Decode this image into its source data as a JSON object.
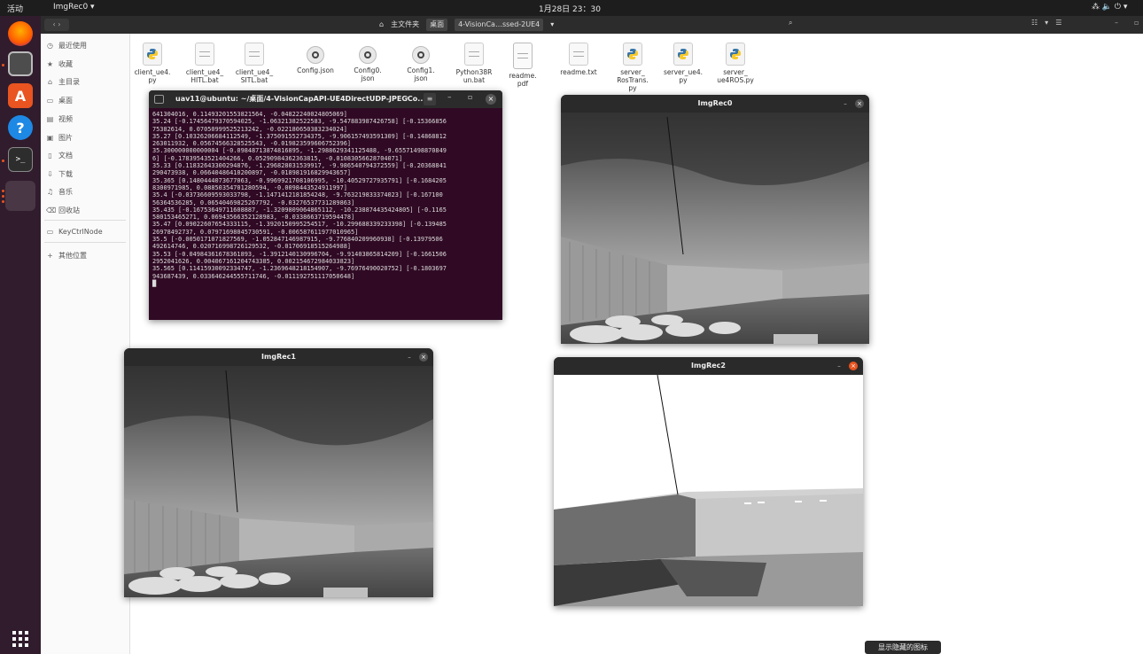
{
  "topbar": {
    "activities": "活动",
    "app_menu": "ImgRec0 ▾",
    "clock": "1月28日 23：30",
    "status_icons": "⁂ 🔈 ⏻ ▾"
  },
  "toolbar": {
    "path": [
      "主文件夹",
      "桌面",
      "4-VisionCa…ssed-2UE4"
    ],
    "path_dropdown": "▾"
  },
  "sidebar": {
    "items": [
      {
        "label": "最近使用",
        "icon": "clock-icon"
      },
      {
        "label": "收藏",
        "icon": "star-icon"
      },
      {
        "label": "主目录",
        "icon": "home-icon"
      },
      {
        "label": "桌面",
        "icon": "desktop-icon"
      },
      {
        "label": "视频",
        "icon": "video-icon"
      },
      {
        "label": "图片",
        "icon": "picture-icon"
      },
      {
        "label": "文档",
        "icon": "document-icon"
      },
      {
        "label": "下载",
        "icon": "download-icon"
      },
      {
        "label": "音乐",
        "icon": "music-icon"
      },
      {
        "label": "回收站",
        "icon": "trash-icon"
      },
      {
        "label": "KeyCtrlNode",
        "icon": "drive-icon"
      },
      {
        "label": "其他位置",
        "icon": "plus-icon"
      }
    ]
  },
  "files": [
    {
      "name": "client_ue4.\npy",
      "type": "python"
    },
    {
      "name": "client_ue4_\nHITL.bat",
      "type": "text"
    },
    {
      "name": "client_ue4_\nSITL.bat",
      "type": "text"
    },
    {
      "name": "Config.json",
      "type": "json"
    },
    {
      "name": "Config0.\njson",
      "type": "json"
    },
    {
      "name": "Config1.\njson",
      "type": "json"
    },
    {
      "name": "Python38R\nun.bat",
      "type": "text"
    },
    {
      "name": "readme.\npdf",
      "type": "pdf"
    },
    {
      "name": "readme.txt",
      "type": "text"
    },
    {
      "name": "server_\nRosTrans.\npy",
      "type": "python"
    },
    {
      "name": "server_ue4.\npy",
      "type": "python"
    },
    {
      "name": "server_\nue4ROS.py",
      "type": "python"
    }
  ],
  "terminal": {
    "title": "uav11@ubuntu: ~/桌面/4-VisionCapAPI-UE4DirectUDP-JPEGCo...",
    "lines": [
      "641304016, 0.11493201553821564, -0.04822240024805069]",
      "35.24 [-0.17456479370594025, -1.06321382522583, -9.547883987426758] [-0.15366856",
      "75382614, 0.07050999525213242, -0.022180650383234024]",
      "35.27 [0.10326206684112549, -1.375091552734375, -9.906157493591309] [-0.14868812",
      "263011932, 0.05674566328525543, -0.019823599606752396]",
      "35.300000000000004 [-0.09848713874816895, -1.2988629341125488, -9.65571498870849",
      "6] [-0.17839543521404266, 0.05290984362363815, -0.01083056628704071]",
      "35.33 [0.11832643300294876, -1.296828031539917, -9.986540794372559] [-0.20368841",
      "290473938, 0.06640486410200897, -0.018981916829943657]",
      "35.365 [0.1480444073677063, -0.9969921708106995, -10.40529727935791] [-0.1684205",
      "8300971985, 0.08850354701280594, -0.0098443524911997]",
      "35.4 [-0.03736609593033798, -1.1471412181854248, -9.763219833374023] [-0.167100",
      "56364536285, 0.06540469825267792, -0.03276537731289863]",
      "35.435 [-0.16753649711608887, -1.3209809064865112, -10.238874435424805] [-0.1165",
      "580153465271, 0.06943566352128983, -0.0338663719594478]",
      "35.47 [0.09022607654333115, -1.3920150995254517, -10.299688339233398] [-0.139485",
      "26978492737, 0.07971698045730591, -0.006587611977010965]",
      "35.5 [-0.0050171071827569, -1.052847146987915, -9.776840209960938] [-0.13979506",
      "492614746, 0.020716998726129532, -0.01706918515264988]",
      "35.53 [-0.04984361678361893, -1.3912140130996704, -9.91403865814209] [-0.1661506",
      "2952041626, 0.004067161204743385, 0.002154672984033823]",
      "35.565 [0.11415930092334747, -1.2369648218154907, -9.76976490020752] [-0.1803697",
      "943687439, 0.033646244555711746, -0.011192751117050648]",
      "█"
    ]
  },
  "windows": {
    "imgrec0": "ImgRec0",
    "imgrec1": "ImgRec1",
    "imgrec2": "ImgRec2"
  },
  "tooltip": "显示隐藏的图标",
  "colors": {
    "ubuntu_orange": "#e95420",
    "terminal_bg": "#300a24",
    "dock_bg": "#301c2c"
  }
}
